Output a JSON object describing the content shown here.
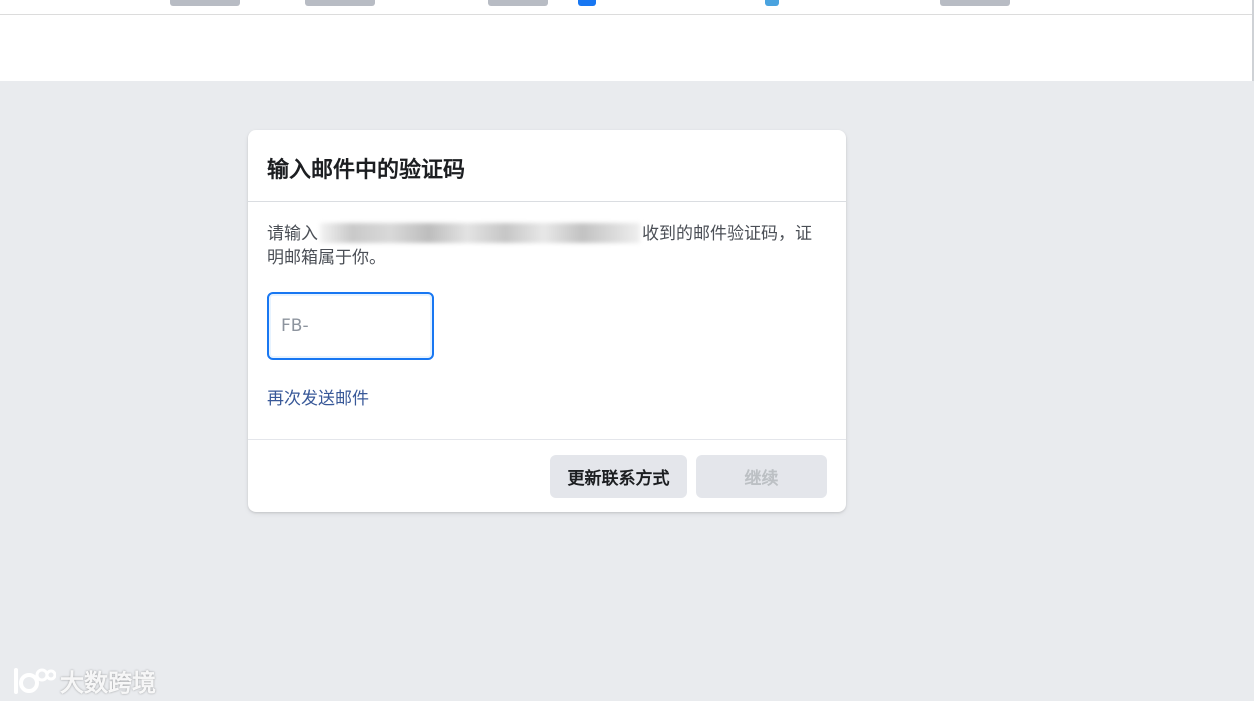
{
  "card": {
    "title": "输入邮件中的验证码",
    "description_prefix": "请输入",
    "description_suffix": "收到的邮件验证码，证明邮箱属于你。",
    "code_placeholder": "FB-",
    "code_value": "",
    "resend_link": "再次发送邮件",
    "update_contact_button": "更新联系方式",
    "continue_button": "继续"
  },
  "watermark": {
    "text": "大数跨境"
  },
  "colors": {
    "background": "#e9ebee",
    "card": "#ffffff",
    "accent": "#1877f2",
    "link": "#385898",
    "button_bg": "#e4e6eb",
    "disabled_text": "#bcc0c4"
  }
}
